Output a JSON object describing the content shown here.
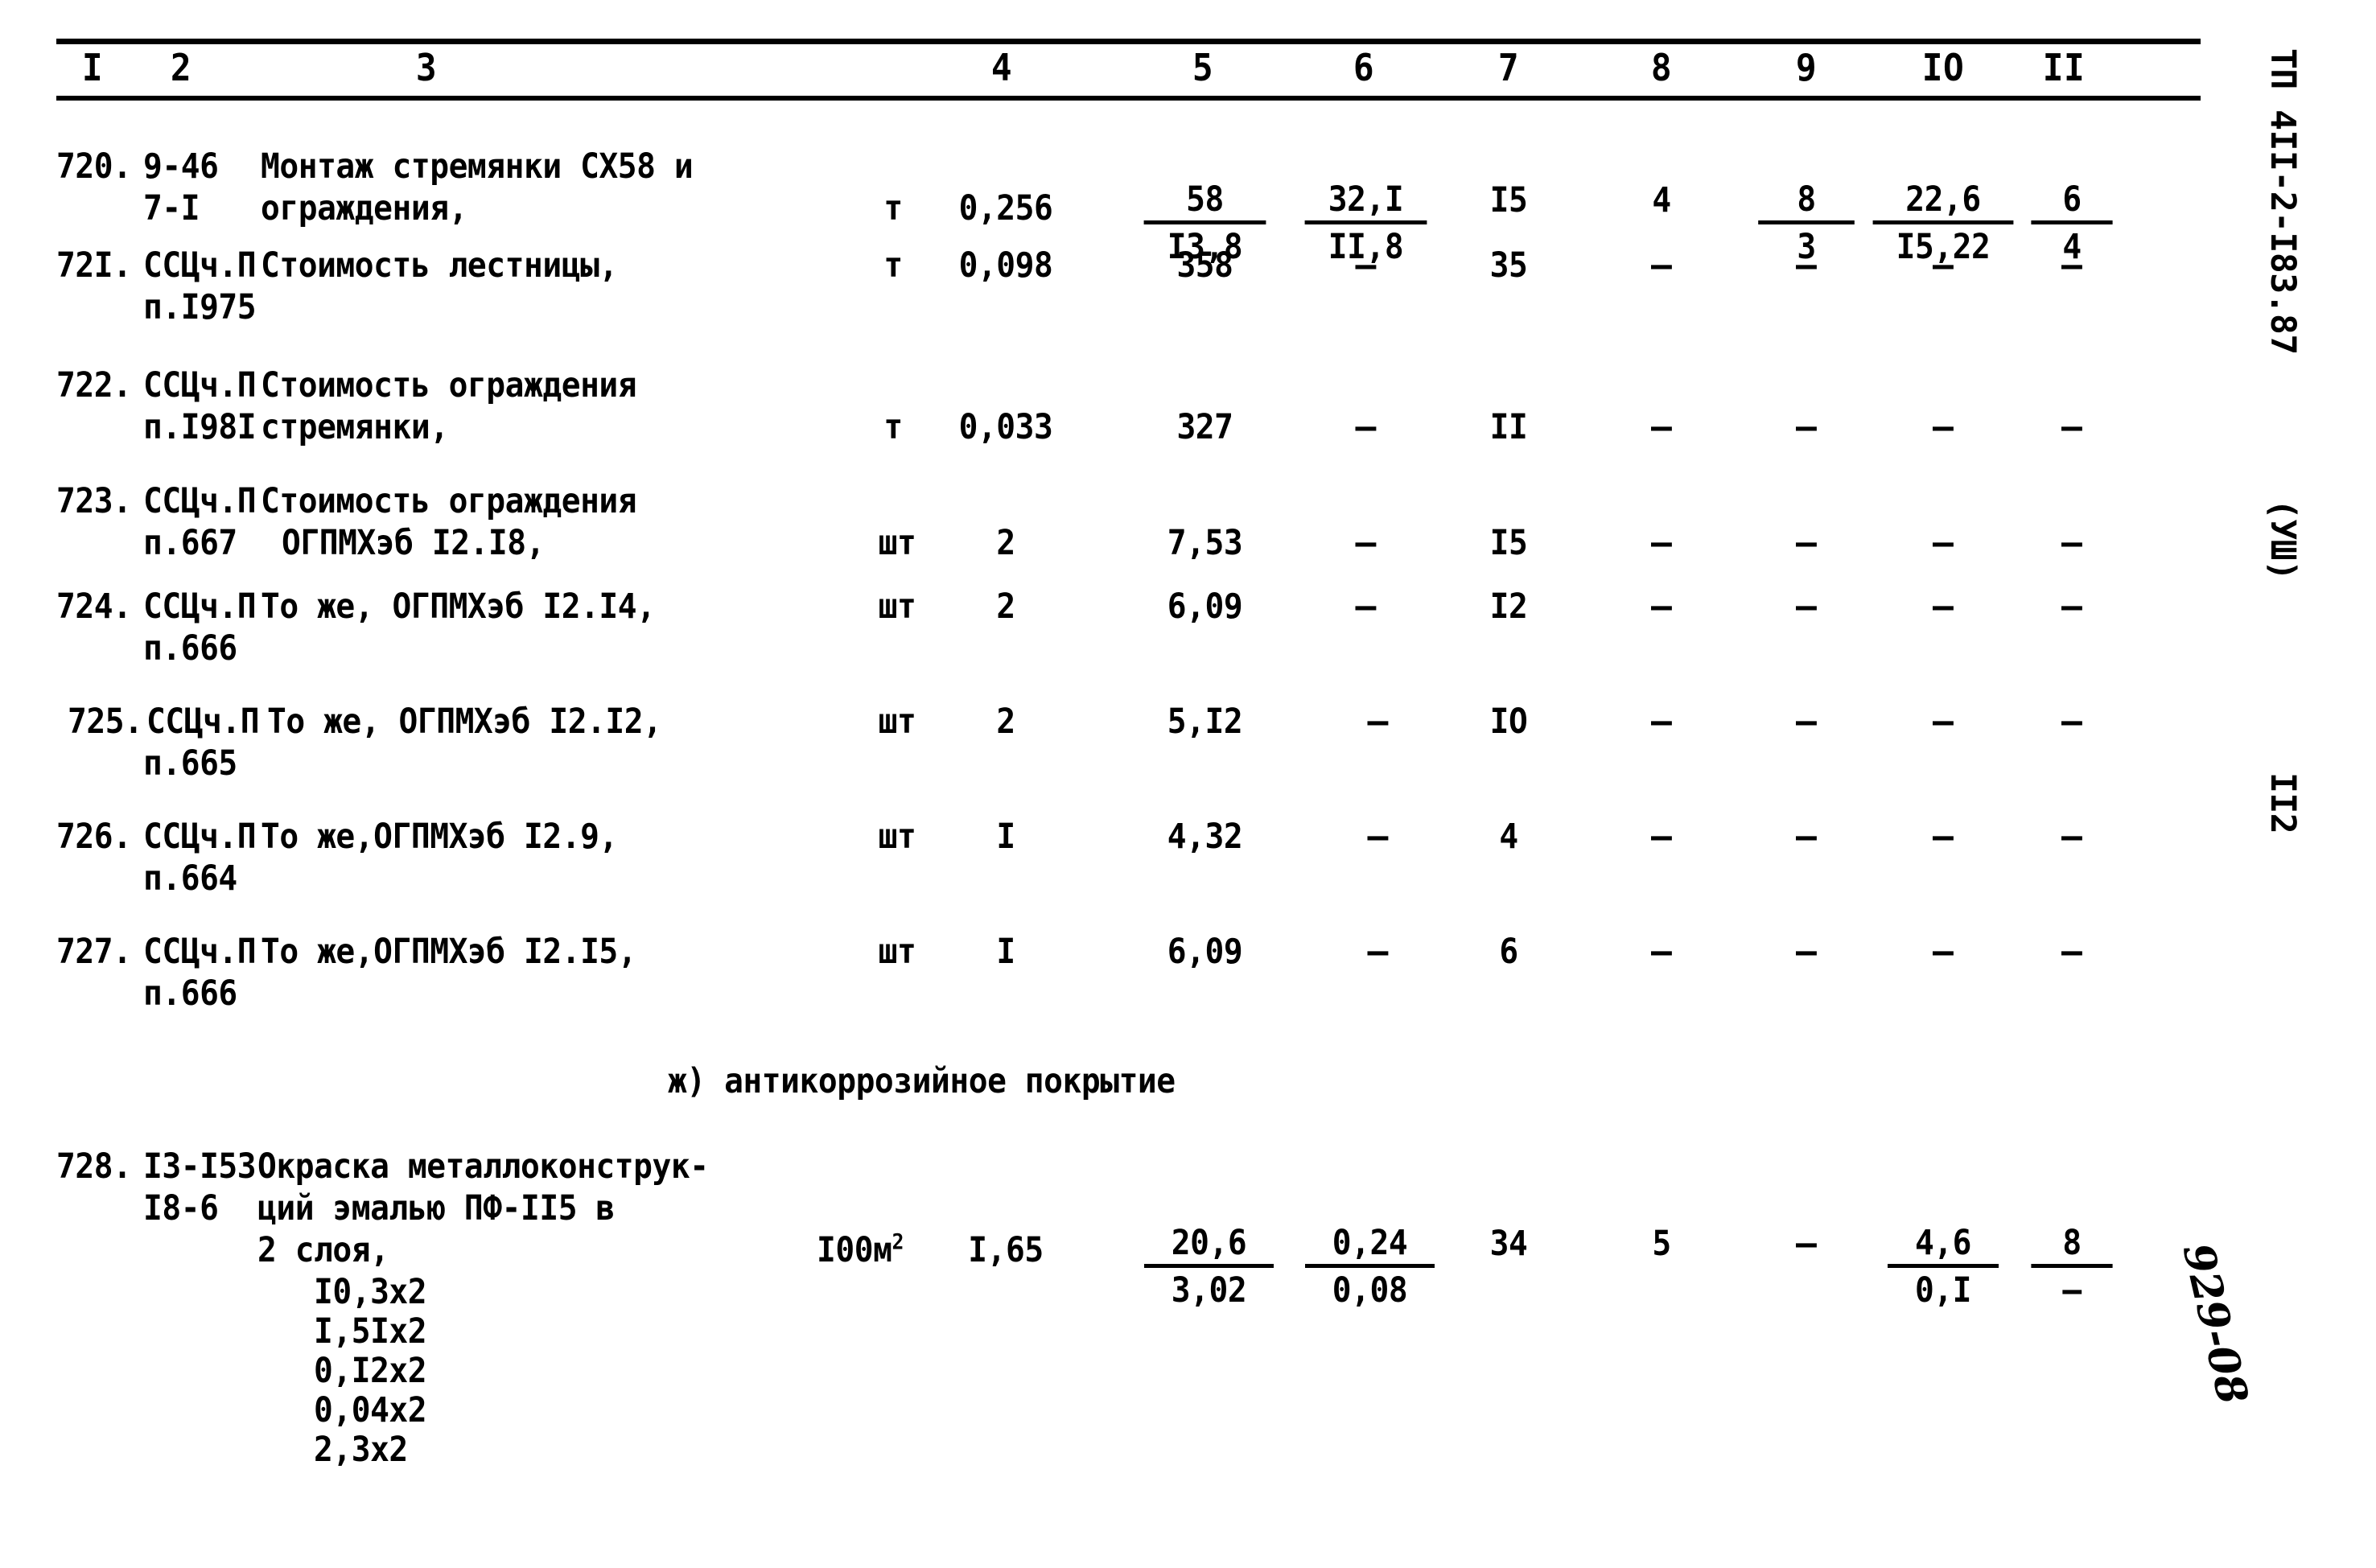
{
  "document": {
    "sidebar_code": "ТП 4II-2-I83.87",
    "sidebar_section": "(УШ)",
    "page_number": "II2",
    "handwritten_note": "929-08"
  },
  "table": {
    "column_headers": [
      "I",
      "2",
      "3",
      "4",
      "5",
      "6",
      "7",
      "8",
      "9",
      "IO",
      "II"
    ],
    "rows": [
      {
        "no": "720.",
        "code_line1": "9-46",
        "code_line2": "7-I",
        "desc_line1": "Монтаж стремянки СХ58 и",
        "desc_line2": "ограждения,",
        "unit": "т",
        "c4": "0,256",
        "c5_num": "58",
        "c5_den": "I3,8",
        "c6_num": "32,I",
        "c6_den": "II,8",
        "c7": "I5",
        "c8": "4",
        "c9_num": "8",
        "c9_den": "3",
        "c10_num": "22,6",
        "c10_den": "I5,22",
        "c11_num": "6",
        "c11_den": "4"
      },
      {
        "no": "72I.",
        "code_line1": "ССЦч.П",
        "code_line2": "п.I975",
        "desc_line1": "Стоимость лестницы,",
        "desc_line2": "",
        "unit": "т",
        "c4": "0,098",
        "c5": "358",
        "c6": "–",
        "c7": "35",
        "c8": "–",
        "c9": "–",
        "c10": "–",
        "c11": "–"
      },
      {
        "no": "722.",
        "code_line1": "ССЦч.П",
        "code_line2": "п.I98I",
        "desc_line1": "Стоимость ограждения",
        "desc_line2": "стремянки,",
        "unit": "т",
        "c4": "0,033",
        "c5": "327",
        "c6": "–",
        "c7": "II",
        "c8": "–",
        "c9": "–",
        "c10": "–",
        "c11": "–"
      },
      {
        "no": "723.",
        "code_line1": "ССЦч.П",
        "code_line2": "п.667",
        "desc_line1": "Стоимость ограждения",
        "desc_line2": "ОГПМХэб I2.I8,",
        "unit": "шт",
        "c4": "2",
        "c5": "7,53",
        "c6": "–",
        "c7": "I5",
        "c8": "–",
        "c9": "–",
        "c10": "–",
        "c11": "–"
      },
      {
        "no": "724.",
        "code_line1": "ССЦч.П",
        "code_line2": "п.666",
        "desc_line1": "То же, ОГПМХэб I2.I4,",
        "desc_line2": "",
        "unit": "шт",
        "c4": "2",
        "c5": "6,09",
        "c6": "–",
        "c7": "I2",
        "c8": "–",
        "c9": "–",
        "c10": "–",
        "c11": "–"
      },
      {
        "no": "725.",
        "code_line1": "ССЦч.П",
        "code_line2": "п.665",
        "desc_line1": "То же, ОГПМХэб I2.I2,",
        "desc_line2": "",
        "unit": "шт",
        "c4": "2",
        "c5": "5,I2",
        "c6": "–",
        "c7": "IO",
        "c8": "–",
        "c9": "–",
        "c10": "–",
        "c11": "–"
      },
      {
        "no": "726.",
        "code_line1": "ССЦч.П",
        "code_line2": "п.664",
        "desc_line1": "То же,ОГПМХэб I2.9,",
        "desc_line2": "",
        "unit": "шт",
        "c4": "I",
        "c5": "4,32",
        "c6": "–",
        "c7": "4",
        "c8": "–",
        "c9": "–",
        "c10": "–",
        "c11": "–"
      },
      {
        "no": "727.",
        "code_line1": "ССЦч.П",
        "code_line2": "п.666",
        "desc_line1": "То же,ОГПМХэб I2.I5,",
        "desc_line2": "",
        "unit": "шт",
        "c4": "I",
        "c5": "6,09",
        "c6": "–",
        "c7": "6",
        "c8": "–",
        "c9": "–",
        "c10": "–",
        "c11": "–"
      }
    ],
    "section_heading": "ж) антикоррозийное покрытие",
    "last_row": {
      "no": "728.",
      "code_line1": "I3-I53",
      "code_line2": "I8-6",
      "desc_line1": "Окраска металлоконструк-",
      "desc_line2": "ций эмалью ПФ-II5 в",
      "desc_line3": "2 слоя,",
      "sub_items": [
        "I0,3x2",
        "I,5Ix2",
        "0,I2x2",
        "0,04x2",
        "2,3x2"
      ],
      "unit_base": "I00м",
      "unit_sup": "2",
      "c4": "I,65",
      "c5_num": "20,6",
      "c5_den": "3,02",
      "c6_num": "0,24",
      "c6_den": "0,08",
      "c7": "34",
      "c8": "5",
      "c9": "–",
      "c10_num": "4,6",
      "c10_den": "0,I",
      "c11_num": "8",
      "c11_den": "–"
    }
  }
}
